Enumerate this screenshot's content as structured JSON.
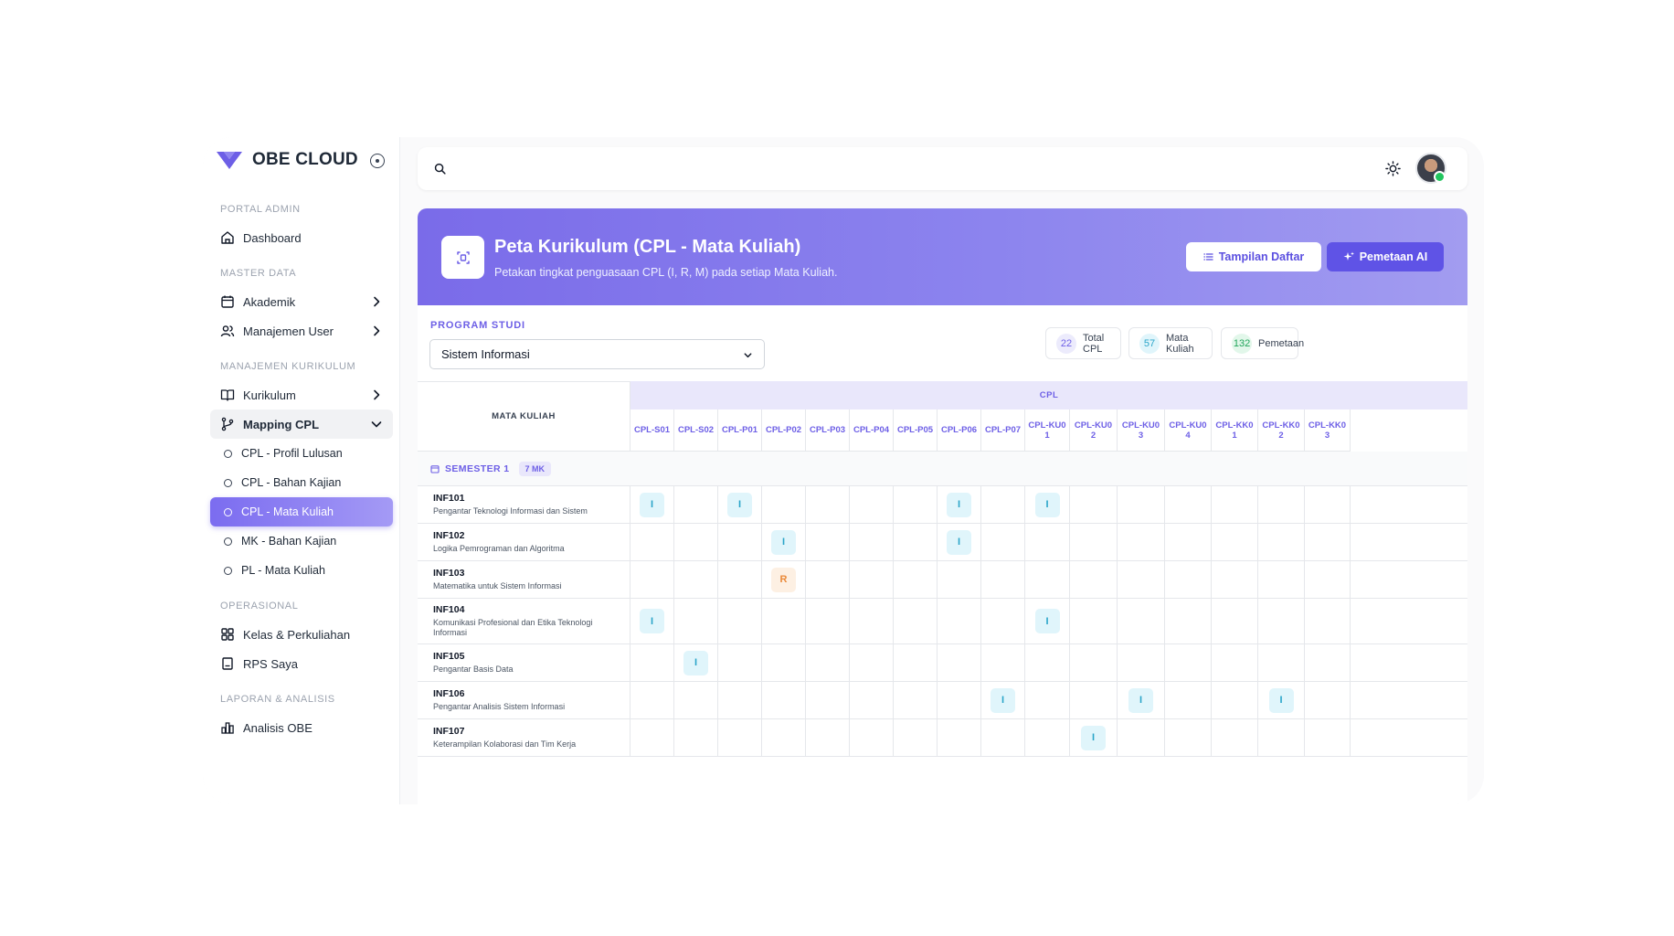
{
  "app": {
    "name": "OBE CLOUD"
  },
  "sidebar": {
    "sections": [
      {
        "label": "PORTAL ADMIN",
        "items": [
          {
            "label": "Dashboard",
            "icon": "home-icon"
          }
        ]
      },
      {
        "label": "MASTER DATA",
        "items": [
          {
            "label": "Akademik",
            "icon": "calendar-icon",
            "chevron": true
          },
          {
            "label": "Manajemen User",
            "icon": "users-icon",
            "chevron": true
          }
        ]
      },
      {
        "label": "MANAJEMEN KURIKULUM",
        "items": [
          {
            "label": "Kurikulum",
            "icon": "book-icon",
            "chevron": true
          },
          {
            "label": "Mapping CPL",
            "icon": "git-branch-icon",
            "expanded": true
          }
        ]
      },
      {
        "label": "OPERASIONAL",
        "items": [
          {
            "label": "Kelas & Perkuliahan",
            "icon": "grid-icon"
          },
          {
            "label": "RPS Saya",
            "icon": "notebook-icon"
          }
        ]
      },
      {
        "label": "LAPORAN & ANALISIS",
        "items": [
          {
            "label": "Analisis OBE",
            "icon": "bar-chart-icon"
          }
        ]
      }
    ],
    "mapping_sub": [
      {
        "label": "CPL - Profil Lulusan"
      },
      {
        "label": "CPL - Bahan Kajian"
      },
      {
        "label": "CPL - Mata Kuliah",
        "active": true
      },
      {
        "label": "MK - Bahan Kajian"
      },
      {
        "label": "PL - Mata Kuliah"
      }
    ]
  },
  "header": {
    "title": "Peta Kurikulum (CPL - Mata Kuliah)",
    "subtitle": "Petakan tingkat penguasaan CPL (I, R, M) pada setiap Mata Kuliah.",
    "btn_list": "Tampilan Daftar",
    "btn_ai": "Pemetaan AI"
  },
  "filter": {
    "label": "PROGRAM STUDI",
    "value": "Sistem Informasi"
  },
  "stats": [
    {
      "value": "22",
      "label": "Total CPL",
      "color": "#6d5fe6",
      "bg": "#ecebfc"
    },
    {
      "value": "57",
      "label": "Mata Kuliah",
      "color": "#2aa5c9",
      "bg": "#e0f5fb"
    },
    {
      "value": "132",
      "label": "Pemetaan",
      "color": "#22a55b",
      "bg": "#e2f7ea"
    }
  ],
  "matrix": {
    "mk_header": "MATA KULIAH",
    "cpl_header": "CPL",
    "columns": [
      "CPL-S01",
      "CPL-S02",
      "CPL-P01",
      "CPL-P02",
      "CPL-P03",
      "CPL-P04",
      "CPL-P05",
      "CPL-P06",
      "CPL-P07",
      "CPL-KU01",
      "CPL-KU02",
      "CPL-KU03",
      "CPL-KU04",
      "CPL-KK01",
      "CPL-KK02",
      "CPL-KK03"
    ],
    "semester": {
      "label": "SEMESTER 1",
      "badge": "7 MK"
    },
    "rows": [
      {
        "code": "INF101",
        "name": "Pengantar Teknologi Informasi dan Sistem",
        "map": {
          "0": "I",
          "2": "I",
          "7": "I",
          "9": "I"
        }
      },
      {
        "code": "INF102",
        "name": "Logika Pemrograman dan Algoritma",
        "map": {
          "3": "I",
          "7": "I"
        }
      },
      {
        "code": "INF103",
        "name": "Matematika untuk Sistem Informasi",
        "map": {
          "3": "R"
        }
      },
      {
        "code": "INF104",
        "name": "Komunikasi Profesional dan Etika Teknologi Informasi",
        "map": {
          "0": "I",
          "9": "I"
        }
      },
      {
        "code": "INF105",
        "name": "Pengantar Basis Data",
        "map": {
          "1": "I"
        }
      },
      {
        "code": "INF106",
        "name": "Pengantar Analisis Sistem Informasi",
        "map": {
          "8": "I",
          "11": "I",
          "14": "I"
        }
      },
      {
        "code": "INF107",
        "name": "Keterampilan Kolaborasi dan Tim Kerja",
        "map": {
          "10": "I"
        }
      }
    ]
  }
}
